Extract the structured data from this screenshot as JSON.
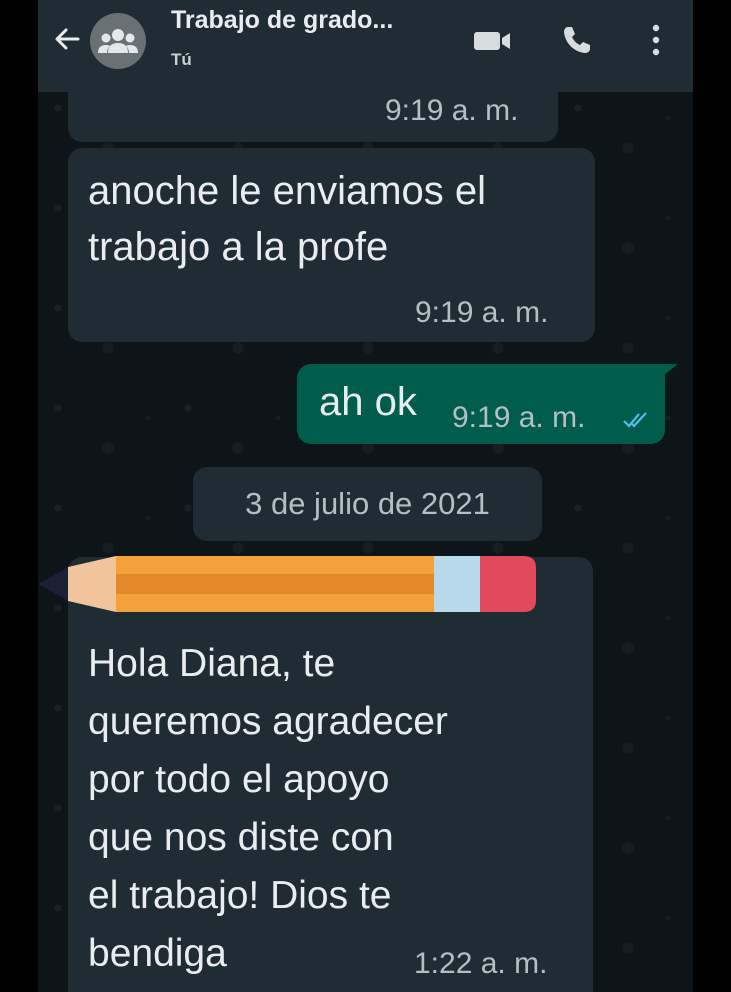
{
  "header": {
    "title": "Trabajo de grado...",
    "subtitle": "Tú",
    "icons": [
      "back-arrow-icon",
      "group-avatar-icon",
      "video-call-icon",
      "phone-icon",
      "more-vertical-icon"
    ]
  },
  "messages": [
    {
      "direction": "incoming",
      "text": "",
      "time": "9:19 a. m."
    },
    {
      "direction": "incoming",
      "text": "anoche le enviamos el\ntrabajo a la profe",
      "time": "9:19 a. m."
    },
    {
      "direction": "outgoing",
      "text": "ah ok",
      "time": "9:19 a. m.",
      "status": "read-double-check"
    },
    {
      "direction": "incoming",
      "text": "Hola Diana, te\nqueremos agradecer\npor todo el apoyo\nque nos diste con\nel trabajo! Dios te\nbendiga",
      "time": "1:22 a. m.",
      "image": "pencil-emoji"
    }
  ],
  "date_separator": "3 de julio de 2021",
  "colors": {
    "header_bg": "#1f2c34",
    "incoming_bubble": "#1f2c34",
    "outgoing_bubble": "#005c4b",
    "chat_bg": "#0e1518",
    "read_check": "#53bdeb"
  }
}
